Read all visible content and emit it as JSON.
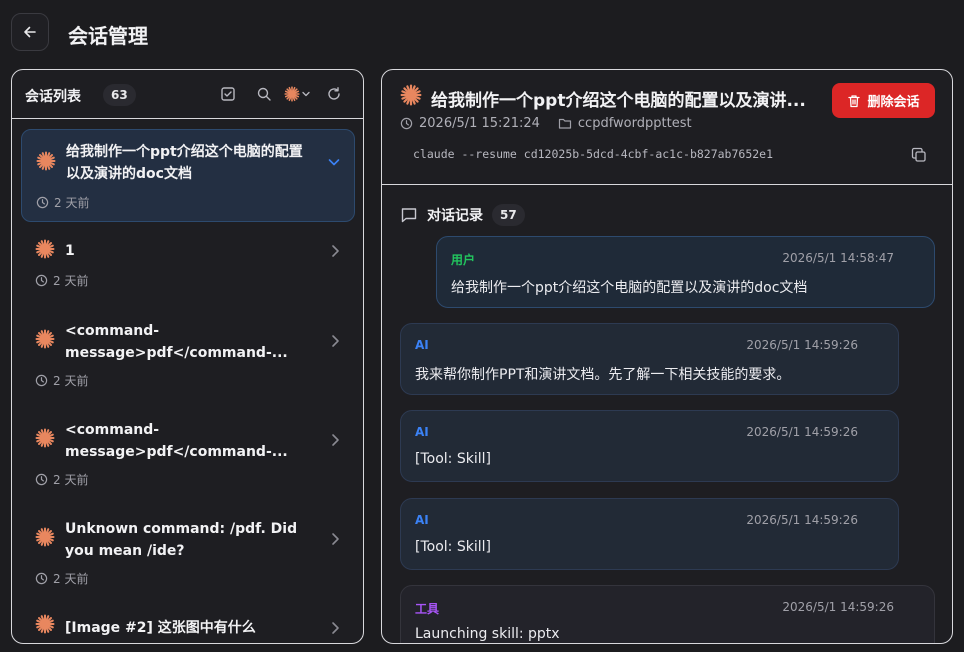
{
  "header": {
    "title": "会话管理"
  },
  "sidebar": {
    "title": "会话列表",
    "count": "63",
    "items": [
      {
        "title": "给我制作一个ppt介绍这个电脑的配置以及演讲的doc文档",
        "time": "2 天前",
        "active": true
      },
      {
        "title": "1",
        "time": "2 天前"
      },
      {
        "title": "<command-message>pdf</command-...",
        "time": "2 天前"
      },
      {
        "title": "<command-message>pdf</command-...",
        "time": "2 天前"
      },
      {
        "title": "Unknown command: /pdf. Did you mean /ide?",
        "time": "2 天前"
      },
      {
        "title": "[Image #2] 这张图中有什么",
        "time": ""
      }
    ]
  },
  "detail": {
    "title": "给我制作一个ppt介绍这个电脑的配置以及演讲...",
    "delete_label": "删除会话",
    "datetime": "2026/5/1 15:21:24",
    "folder": "ccpdfwordppttest",
    "command": "claude --resume cd12025b-5dcd-4cbf-ac1c-b827ab7652e1",
    "conversation_label": "对话记录",
    "conversation_count": "57",
    "messages": [
      {
        "role": "用户",
        "time": "2026/5/1 14:58:47",
        "text": "给我制作一个ppt介绍这个电脑的配置以及演讲的doc文档"
      },
      {
        "role": "AI",
        "time": "2026/5/1 14:59:26",
        "text": "我来帮你制作PPT和演讲文档。先了解一下相关技能的要求。"
      },
      {
        "role": "AI",
        "time": "2026/5/1 14:59:26",
        "text": "[Tool: Skill]"
      },
      {
        "role": "AI",
        "time": "2026/5/1 14:59:26",
        "text": "[Tool: Skill]"
      },
      {
        "role": "工具",
        "time": "2026/5/1 14:59:26",
        "text": "Launching skill: pptx"
      }
    ]
  },
  "colors": {
    "accent": "#3b82f6",
    "user_role": "#22c55e",
    "ai_role": "#3b82f6",
    "tool_role": "#a855f7",
    "danger": "#dc2626",
    "claude_orange": "#e8875f"
  }
}
